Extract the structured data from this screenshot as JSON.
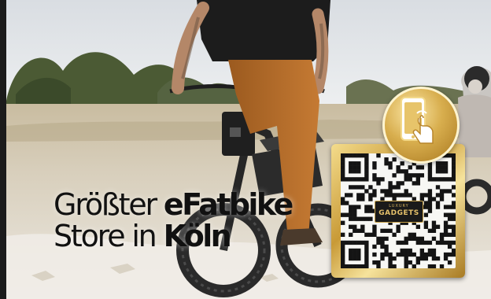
{
  "headline": {
    "line1_regular": "Größter",
    "line1_bold": "eFatbike",
    "line2_regular": "Store in",
    "line2_bold": "Köln"
  },
  "qr": {
    "logo_top": "LUXURY",
    "logo_bottom": "GADGETS"
  },
  "badge": {
    "icon": "phone-tap-icon"
  },
  "colors": {
    "gold_light": "#f4dc8c",
    "gold_dark": "#a87a22",
    "headline_text": "#111111"
  }
}
